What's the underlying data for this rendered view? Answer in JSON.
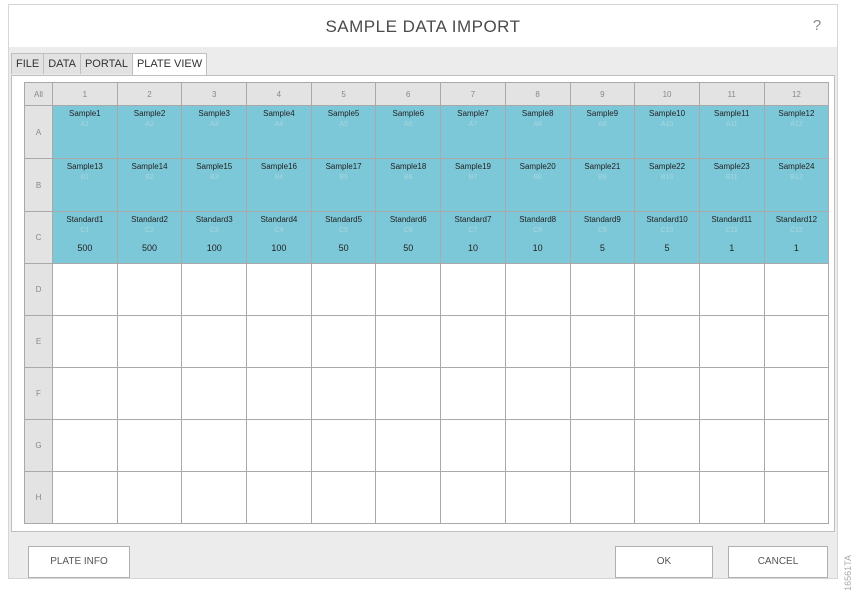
{
  "window": {
    "title": "SAMPLE DATA IMPORT",
    "help": "?"
  },
  "tabs": [
    "FILE",
    "DATA",
    "PORTAL",
    "PLATE VIEW"
  ],
  "active_tab": "PLATE VIEW",
  "plate": {
    "corner": "All",
    "columns": [
      "1",
      "2",
      "3",
      "4",
      "5",
      "6",
      "7",
      "8",
      "9",
      "10",
      "11",
      "12"
    ],
    "rows": [
      {
        "label": "A",
        "wells": [
          {
            "name": "Sample1",
            "id": "A1"
          },
          {
            "name": "Sample2",
            "id": "A2"
          },
          {
            "name": "Sample3",
            "id": "A3"
          },
          {
            "name": "Sample4",
            "id": "A4"
          },
          {
            "name": "Sample5",
            "id": "A5"
          },
          {
            "name": "Sample6",
            "id": "A6"
          },
          {
            "name": "Sample7",
            "id": "A7"
          },
          {
            "name": "Sample8",
            "id": "A8"
          },
          {
            "name": "Sample9",
            "id": "A9"
          },
          {
            "name": "Sample10",
            "id": "A10"
          },
          {
            "name": "Sample11",
            "id": "A11"
          },
          {
            "name": "Sample12",
            "id": "A12"
          }
        ]
      },
      {
        "label": "B",
        "wells": [
          {
            "name": "Sample13",
            "id": "B1"
          },
          {
            "name": "Sample14",
            "id": "B2"
          },
          {
            "name": "Sample15",
            "id": "B3"
          },
          {
            "name": "Sample16",
            "id": "B4"
          },
          {
            "name": "Sample17",
            "id": "B5"
          },
          {
            "name": "Sample18",
            "id": "B6"
          },
          {
            "name": "Sample19",
            "id": "B7"
          },
          {
            "name": "Sample20",
            "id": "B8"
          },
          {
            "name": "Sample21",
            "id": "B9"
          },
          {
            "name": "Sample22",
            "id": "B10"
          },
          {
            "name": "Sample23",
            "id": "B11"
          },
          {
            "name": "Sample24",
            "id": "B12"
          }
        ]
      },
      {
        "label": "C",
        "wells": [
          {
            "name": "Standard1",
            "id": "C1",
            "qty": "500"
          },
          {
            "name": "Standard2",
            "id": "C2",
            "qty": "500"
          },
          {
            "name": "Standard3",
            "id": "C3",
            "qty": "100"
          },
          {
            "name": "Standard4",
            "id": "C4",
            "qty": "100"
          },
          {
            "name": "Standard5",
            "id": "C5",
            "qty": "50"
          },
          {
            "name": "Standard6",
            "id": "C6",
            "qty": "50"
          },
          {
            "name": "Standard7",
            "id": "C7",
            "qty": "10"
          },
          {
            "name": "Standard8",
            "id": "C8",
            "qty": "10"
          },
          {
            "name": "Standard9",
            "id": "C9",
            "qty": "5"
          },
          {
            "name": "Standard10",
            "id": "C10",
            "qty": "5"
          },
          {
            "name": "Standard11",
            "id": "C11",
            "qty": "1"
          },
          {
            "name": "Standard12",
            "id": "C12",
            "qty": "1"
          }
        ]
      },
      {
        "label": "D",
        "wells": []
      },
      {
        "label": "E",
        "wells": []
      },
      {
        "label": "F",
        "wells": []
      },
      {
        "label": "G",
        "wells": []
      },
      {
        "label": "H",
        "wells": []
      }
    ]
  },
  "buttons": {
    "plate_info": "PLATE INFO",
    "ok": "OK",
    "cancel": "CANCEL"
  },
  "figure_id": "16561TA",
  "colors": {
    "well_filled": "#7dc8d8",
    "header_bg": "#e3e3e3",
    "window_bg": "#ececec"
  }
}
